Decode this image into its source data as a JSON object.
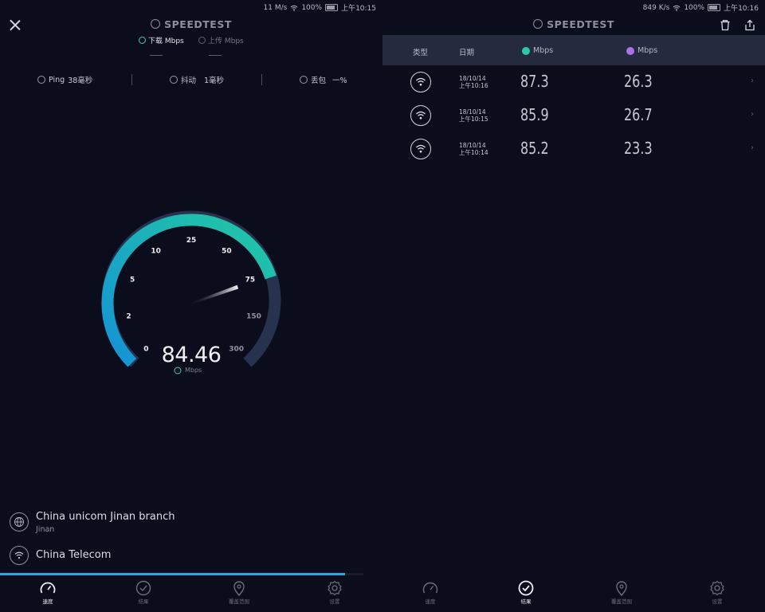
{
  "left": {
    "status": {
      "speed": "11 M/s",
      "battery": "100%",
      "time": "上午10:15"
    },
    "app_title": "SPEEDTEST",
    "tabs": {
      "download": "下载 Mbps",
      "upload": "上传 Mbps"
    },
    "metrics": {
      "ping_label": "Ping",
      "ping_value": "38毫秒",
      "jitter_label": "抖动",
      "jitter_value": "1毫秒",
      "loss_label": "丢包",
      "loss_value": "一%"
    },
    "gauge": {
      "ticks": [
        "0",
        "2",
        "5",
        "10",
        "25",
        "50",
        "75",
        "150",
        "300"
      ],
      "value": "84.46",
      "unit": "Mbps",
      "reading": 84.46
    },
    "server": {
      "name": "China unicom Jinan branch",
      "city": "Jinan"
    },
    "provider": "China Telecom",
    "progress": 0.95,
    "nav": [
      "速度",
      "结果",
      "覆盖范围",
      "设置"
    ]
  },
  "right": {
    "status": {
      "speed": "849 K/s",
      "battery": "100%",
      "time": "上午10:16"
    },
    "app_title": "SPEEDTEST",
    "header": {
      "type": "类型",
      "date": "日期",
      "download": "Mbps",
      "upload": "Mbps"
    },
    "rows": [
      {
        "date": "18/10/14",
        "time": "上午10:16",
        "download": "87.3",
        "upload": "26.3"
      },
      {
        "date": "18/10/14",
        "time": "上午10:15",
        "download": "85.9",
        "upload": "26.7"
      },
      {
        "date": "18/10/14",
        "time": "上午10:14",
        "download": "85.2",
        "upload": "23.3"
      }
    ],
    "nav": [
      "速度",
      "结果",
      "覆盖范围",
      "设置"
    ]
  },
  "colors": {
    "background": "#0b0c1c",
    "accent_teal": "#1fc7a4",
    "accent_blue": "#1996d8",
    "header_bar": "#262a3f",
    "upload_purple": "#a874e6"
  }
}
